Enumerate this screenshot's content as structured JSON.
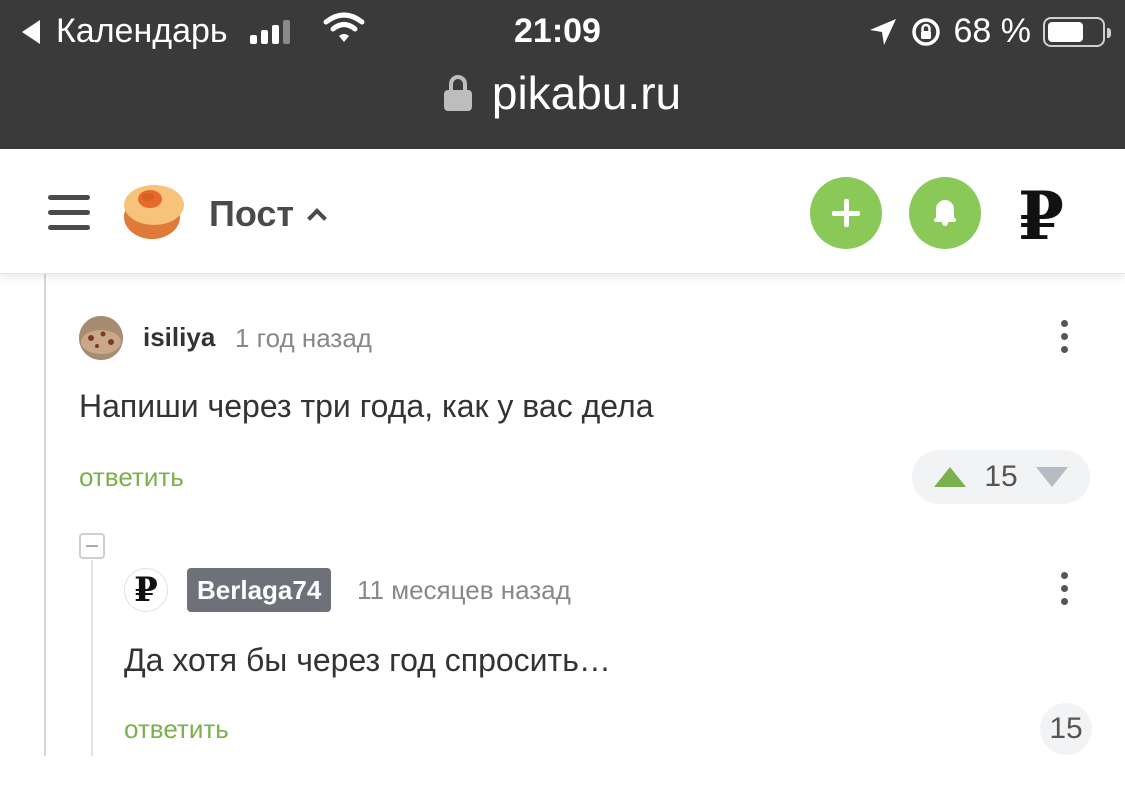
{
  "status_bar": {
    "back_label": "Календарь",
    "time": "21:09",
    "battery_percent": "68 %",
    "battery_level": 0.68,
    "icons": [
      "back-arrow-icon",
      "cellular-signal-icon",
      "wifi-icon",
      "location-arrow-icon",
      "rotation-lock-icon",
      "battery-icon"
    ]
  },
  "address_bar": {
    "url": "pikabu.ru",
    "icon": "lock-icon"
  },
  "header": {
    "title": "Пост",
    "icons": [
      "menu-icon",
      "pikabu-logo",
      "chevron-up-icon",
      "plus-icon",
      "bell-icon",
      "ruble-icon"
    ],
    "accent_color": "#8ac858",
    "ruble_glyph": "₽"
  },
  "comments": [
    {
      "username": "isiliya",
      "time_ago": "1 год назад",
      "text": "Напиши через три года, как у вас дела",
      "reply_label": "ответить",
      "rating": "15"
    },
    {
      "username": "Berlaga74",
      "time_ago": "11 месяцев назад",
      "text": "Да хотя бы через год спросить…",
      "reply_label": "ответить",
      "rating": "15",
      "avatar_glyph": "₽"
    }
  ],
  "colors": {
    "reply_green": "#7ab14c",
    "upvote_green": "#7ab14c",
    "downvote_gray": "#b5bcc4",
    "author_badge": "#6e7278"
  }
}
